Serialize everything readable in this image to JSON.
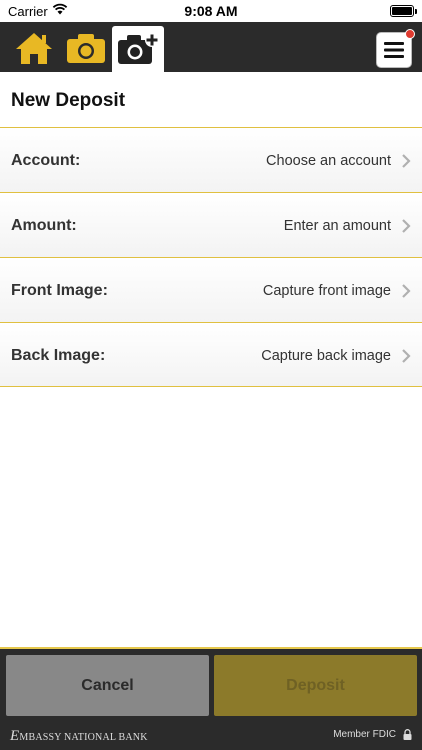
{
  "status": {
    "carrier": "Carrier",
    "time": "9:08 AM"
  },
  "nav": {
    "tabs": [
      {
        "icon": "home-icon"
      },
      {
        "icon": "camera-icon"
      },
      {
        "icon": "camera-add-icon"
      }
    ],
    "menu_icon": "hamburger-menu-icon",
    "badge_color": "#e03a2f"
  },
  "page": {
    "title": "New Deposit"
  },
  "form": {
    "rows": [
      {
        "label": "Account:",
        "value": "Choose an account"
      },
      {
        "label": "Amount:",
        "value": "Enter an amount"
      },
      {
        "label": "Front Image:",
        "value": "Capture front image"
      },
      {
        "label": "Back Image:",
        "value": "Capture back image"
      }
    ]
  },
  "actions": {
    "cancel_label": "Cancel",
    "deposit_label": "Deposit"
  },
  "footer": {
    "bank_initial": "E",
    "bank_rest": "MBASSY NATIONAL BANK",
    "fdic": "Member FDIC"
  },
  "colors": {
    "accent": "#e6c84c",
    "dark": "#2b2b2b",
    "icon_gold": "#e8b824"
  }
}
